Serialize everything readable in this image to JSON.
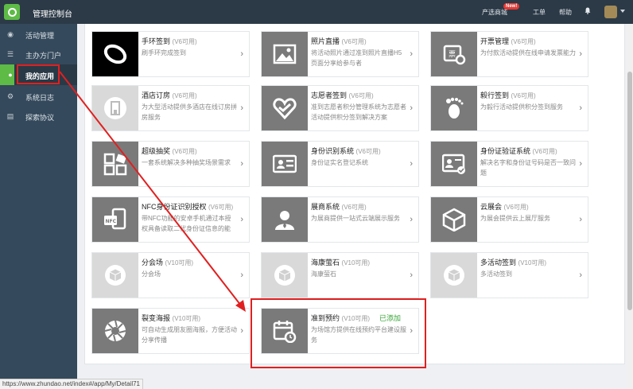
{
  "header": {
    "title": "管理控制台",
    "links": [
      "产选商城",
      "工单",
      "帮助"
    ],
    "new_badge": "New!"
  },
  "sidebar": {
    "items": [
      {
        "label": "活动管理",
        "icon": "dashboard-icon"
      },
      {
        "label": "主办方门户",
        "icon": "list-icon"
      },
      {
        "label": "我的应用",
        "icon": "apps-icon",
        "active": true
      },
      {
        "label": "系统日志",
        "icon": "settings-icon"
      },
      {
        "label": "探索协议",
        "icon": "document-icon"
      }
    ]
  },
  "apps": [
    {
      "name": "手环签到",
      "ver": "(V6可用)",
      "desc": "刷手环完成签到",
      "icon": "wristband-icon",
      "style": "black"
    },
    {
      "name": "照片直播",
      "ver": "(V6可用)",
      "desc": "将活动照片通过准到照片直播H5页面分享给参与者",
      "icon": "photo-icon",
      "style": "gray"
    },
    {
      "name": "开票管理",
      "ver": "(V6可用)",
      "desc": "为付款活动提供在线申请发票能力",
      "icon": "invoice-icon",
      "style": "gray"
    },
    {
      "name": "酒店订房",
      "ver": "(V6可用)",
      "desc": "为大型活动提供多酒店在线订房拼房服务",
      "icon": "hotel-icon",
      "style": "light"
    },
    {
      "name": "志愿者签到",
      "ver": "(V6可用)",
      "desc": "准到志愿者积分管理系统为志愿者活动提供积分签到解决方案",
      "icon": "volunteer-icon",
      "style": "gray"
    },
    {
      "name": "毅行签到",
      "ver": "(V6可用)",
      "desc": "为毅行活动提供积分签到服务",
      "icon": "footprint-icon",
      "style": "gray"
    },
    {
      "name": "超级抽奖",
      "ver": "(V6可用)",
      "desc": "一套系统解决多种抽奖场景需求",
      "icon": "lottery-icon",
      "style": "gray"
    },
    {
      "name": "身份识别系统",
      "ver": "(V6可用)",
      "desc": "身份证实名登记系统",
      "icon": "id-card-icon",
      "style": "gray"
    },
    {
      "name": "身份证验证系统",
      "ver": "(V6可用)",
      "desc": "解决名字和身份证号码是否一致问题",
      "icon": "id-verify-icon",
      "style": "gray"
    },
    {
      "name": "NFC身份证识别授权",
      "ver": "(V6可用)",
      "desc": "带NFC功能的安卓手机通过本授权具备读取二代身份证信息的能",
      "icon": "nfc-icon",
      "style": "gray"
    },
    {
      "name": "展商系统",
      "ver": "(V6可用)",
      "desc": "为展商提供一站式云端展示服务",
      "icon": "exhibitor-icon",
      "style": "gray"
    },
    {
      "name": "云展会",
      "ver": "(V6可用)",
      "desc": "为展会提供云上展厅服务",
      "icon": "cloud-expo-icon",
      "style": "gray"
    },
    {
      "name": "分会场",
      "ver": "(V10可用)",
      "desc": "分会场",
      "icon": "box-icon",
      "style": "light"
    },
    {
      "name": "海康萤石",
      "ver": "(V10可用)",
      "desc": "海康萤石",
      "icon": "box-icon",
      "style": "light"
    },
    {
      "name": "多活动签到",
      "ver": "(V10可用)",
      "desc": "多活动签到",
      "icon": "box-icon",
      "style": "light"
    },
    {
      "name": "裂变海报",
      "ver": "(V10可用)",
      "desc": "可自动生成朋友圈海报，方便活动分享传播",
      "icon": "aperture-icon",
      "style": "gray"
    },
    {
      "name": "准到预约",
      "ver": "(V10可用)",
      "desc": "为场馆方提供在线预约平台建设服务",
      "icon": "calendar-icon",
      "style": "gray",
      "added": "已添加"
    }
  ],
  "status_url": "https://www.zhundao.net/index#/app/My/Detail71",
  "colors": {
    "sidebar": "#34495b",
    "topbar": "#2c3a47",
    "accent_green": "#5dbb46",
    "highlight_red": "#e02020"
  }
}
